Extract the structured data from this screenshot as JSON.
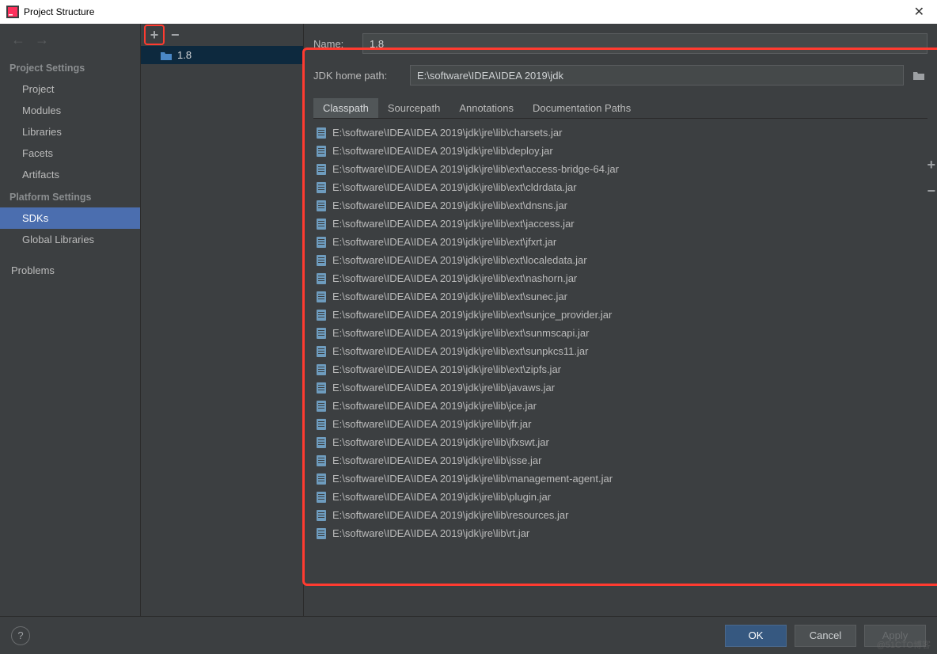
{
  "window": {
    "title": "Project Structure"
  },
  "sidebar": {
    "sections": [
      {
        "header": "Project Settings",
        "items": [
          "Project",
          "Modules",
          "Libraries",
          "Facets",
          "Artifacts"
        ]
      },
      {
        "header": "Platform Settings",
        "items": [
          "SDKs",
          "Global Libraries"
        ]
      },
      {
        "header": "",
        "items": [
          "Problems"
        ]
      }
    ],
    "selected": "SDKs"
  },
  "sdk_list": {
    "items": [
      "1.8"
    ]
  },
  "form": {
    "name_label": "Name:",
    "name_value": "1.8",
    "path_label": "JDK home path:",
    "path_value": "E:\\software\\IDEA\\IDEA 2019\\jdk"
  },
  "tabs": [
    "Classpath",
    "Sourcepath",
    "Annotations",
    "Documentation Paths"
  ],
  "active_tab": "Classpath",
  "classpath": [
    "E:\\software\\IDEA\\IDEA 2019\\jdk\\jre\\lib\\charsets.jar",
    "E:\\software\\IDEA\\IDEA 2019\\jdk\\jre\\lib\\deploy.jar",
    "E:\\software\\IDEA\\IDEA 2019\\jdk\\jre\\lib\\ext\\access-bridge-64.jar",
    "E:\\software\\IDEA\\IDEA 2019\\jdk\\jre\\lib\\ext\\cldrdata.jar",
    "E:\\software\\IDEA\\IDEA 2019\\jdk\\jre\\lib\\ext\\dnsns.jar",
    "E:\\software\\IDEA\\IDEA 2019\\jdk\\jre\\lib\\ext\\jaccess.jar",
    "E:\\software\\IDEA\\IDEA 2019\\jdk\\jre\\lib\\ext\\jfxrt.jar",
    "E:\\software\\IDEA\\IDEA 2019\\jdk\\jre\\lib\\ext\\localedata.jar",
    "E:\\software\\IDEA\\IDEA 2019\\jdk\\jre\\lib\\ext\\nashorn.jar",
    "E:\\software\\IDEA\\IDEA 2019\\jdk\\jre\\lib\\ext\\sunec.jar",
    "E:\\software\\IDEA\\IDEA 2019\\jdk\\jre\\lib\\ext\\sunjce_provider.jar",
    "E:\\software\\IDEA\\IDEA 2019\\jdk\\jre\\lib\\ext\\sunmscapi.jar",
    "E:\\software\\IDEA\\IDEA 2019\\jdk\\jre\\lib\\ext\\sunpkcs11.jar",
    "E:\\software\\IDEA\\IDEA 2019\\jdk\\jre\\lib\\ext\\zipfs.jar",
    "E:\\software\\IDEA\\IDEA 2019\\jdk\\jre\\lib\\javaws.jar",
    "E:\\software\\IDEA\\IDEA 2019\\jdk\\jre\\lib\\jce.jar",
    "E:\\software\\IDEA\\IDEA 2019\\jdk\\jre\\lib\\jfr.jar",
    "E:\\software\\IDEA\\IDEA 2019\\jdk\\jre\\lib\\jfxswt.jar",
    "E:\\software\\IDEA\\IDEA 2019\\jdk\\jre\\lib\\jsse.jar",
    "E:\\software\\IDEA\\IDEA 2019\\jdk\\jre\\lib\\management-agent.jar",
    "E:\\software\\IDEA\\IDEA 2019\\jdk\\jre\\lib\\plugin.jar",
    "E:\\software\\IDEA\\IDEA 2019\\jdk\\jre\\lib\\resources.jar",
    "E:\\software\\IDEA\\IDEA 2019\\jdk\\jre\\lib\\rt.jar"
  ],
  "footer": {
    "ok": "OK",
    "cancel": "Cancel",
    "apply": "Apply",
    "help": "?"
  },
  "watermark": "@51CTO博客"
}
